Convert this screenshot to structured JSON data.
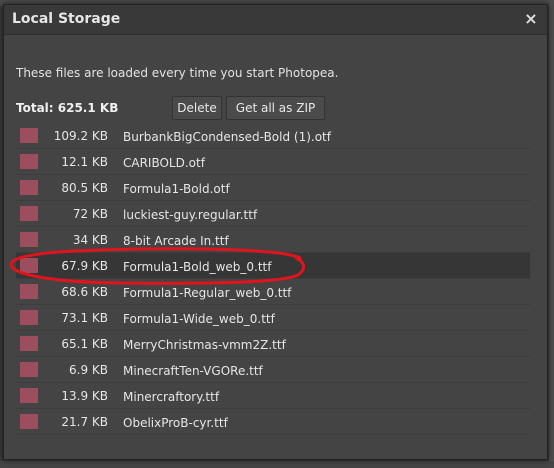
{
  "dialog": {
    "title": "Local Storage",
    "close_glyph": "×",
    "info_text": "These files are loaded every time you start Photopea.",
    "total_label": "Total: 625.1 KB",
    "delete_label": "Delete",
    "zip_label": "Get all as ZIP"
  },
  "files": [
    {
      "size": "109.2 KB",
      "name": "BurbankBigCondensed-Bold (1).otf"
    },
    {
      "size": "12.1 KB",
      "name": "CARIBOLD.otf"
    },
    {
      "size": "80.5 KB",
      "name": "Formula1-Bold.otf"
    },
    {
      "size": "72 KB",
      "name": "luckiest-guy.regular.ttf"
    },
    {
      "size": "34 KB",
      "name": "8-bit Arcade In.ttf"
    },
    {
      "size": "67.9 KB",
      "name": "Formula1-Bold_web_0.ttf"
    },
    {
      "size": "68.6 KB",
      "name": "Formula1-Regular_web_0.ttf"
    },
    {
      "size": "73.1 KB",
      "name": "Formula1-Wide_web_0.ttf"
    },
    {
      "size": "65.1 KB",
      "name": "MerryChristmas-vmm2Z.ttf"
    },
    {
      "size": "6.9 KB",
      "name": "MinecraftTen-VGORe.ttf"
    },
    {
      "size": "13.9 KB",
      "name": "Minercraftory.ttf"
    },
    {
      "size": "21.7 KB",
      "name": "ObelixProB-cyr.ttf"
    }
  ],
  "colors": {
    "swatch": "#9c4e5e",
    "annotation": "#e0141c",
    "dialog_bg": "#444444"
  }
}
